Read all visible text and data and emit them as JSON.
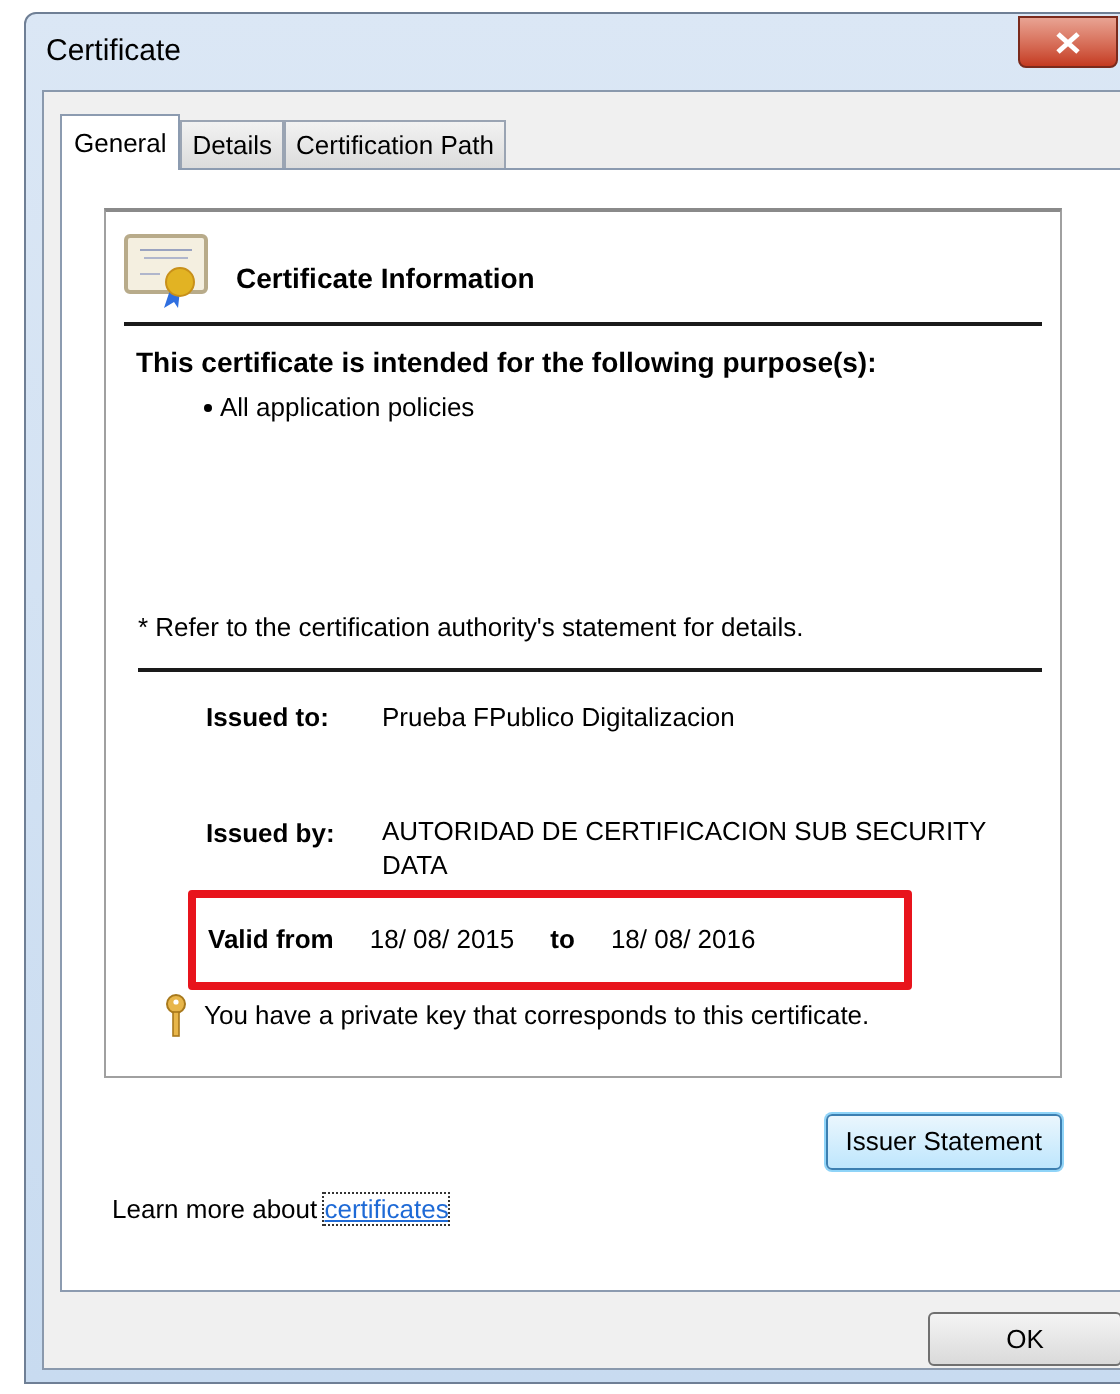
{
  "window": {
    "title": "Certificate"
  },
  "tabs": [
    {
      "label": "General",
      "selected": true
    },
    {
      "label": "Details",
      "selected": false
    },
    {
      "label": "Certification Path",
      "selected": false
    }
  ],
  "info": {
    "heading": "Certificate Information",
    "purpose_heading": "This certificate is intended for the following purpose(s):",
    "purposes": [
      "All application policies"
    ],
    "note": "* Refer to the certification authority's statement for details.",
    "issued_to_label": "Issued to:",
    "issued_to": "Prueba FPublico Digitalizacion",
    "issued_by_label": "Issued by:",
    "issued_by": "AUTORIDAD DE CERTIFICACION SUB SECURITY DATA",
    "valid_from_label": "Valid from",
    "valid_from": "18/ 08/ 2015",
    "to_label": "to",
    "valid_to": "18/ 08/ 2016",
    "private_key": "You have a private key that corresponds to this certificate."
  },
  "issuer_button": "Issuer Statement",
  "learn_more": {
    "text": "Learn more about ",
    "link": "certificates"
  },
  "buttons": [
    "OK"
  ]
}
